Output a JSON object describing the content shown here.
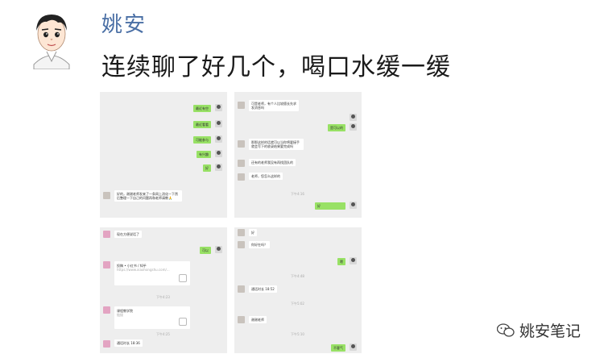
{
  "author": {
    "name": "姚安"
  },
  "post": {
    "text": "连续聊了好几个，喝口水缓一缓"
  },
  "watermark": {
    "name": "姚安笔记"
  },
  "colors": {
    "name_blue": "#4a6fa5",
    "wechat_green": "#98e165",
    "chat_bg": "#eeeeee"
  },
  "shots": {
    "s1": {
      "m1": "最近有空",
      "m2": "最近看看",
      "m3": "可能参与",
      "m4": "有兴趣",
      "m5": "好",
      "m6": "好的，谢谢老师发来了一条网上消化一下然后整理一下自己的问题再和老师请教🙏"
    },
    "s2": {
      "m1": "可是老师，有个人比较擅长先求发消息吗",
      "m2": "是可以的",
      "m3": "那那这样的话就可以当你将要接手就会写下的收录结果要完成吗",
      "m4": "还有的老师我没有再找团队的",
      "m5": "老师，您怎么这样的",
      "ts": "下午4:16",
      "m6": "好"
    },
    "s3": {
      "m1": "现在方便说话了",
      "m2": "可以",
      "card1_title": "投稿 • 小红书 / 知乎",
      "card1_sub": "https://www.xiaohongshu.com/...",
      "ts1": "下午4:23",
      "card2_title": "课程教学院",
      "card2_sub": "链接",
      "ts2": "下午4:25",
      "call": "通话时长 18:36"
    },
    "s4": {
      "m1": "好",
      "m2": "你好在吗？",
      "m3": "嗯",
      "ts1": "下午4:48",
      "call": "通话时长 18:52",
      "ts2": "下午5:02",
      "m4": "谢谢老师",
      "ts3": "下午5:10",
      "m5": "不客气"
    }
  }
}
